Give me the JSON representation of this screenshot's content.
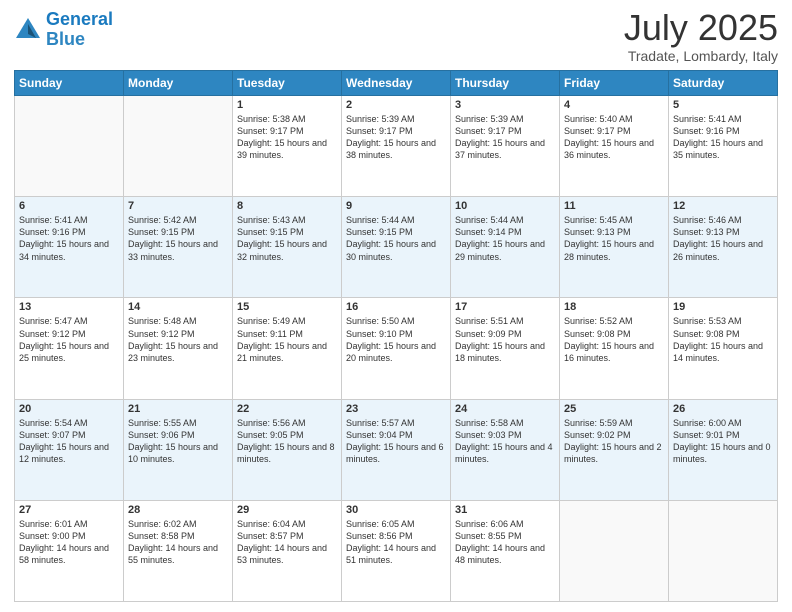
{
  "header": {
    "logo_line1": "General",
    "logo_line2": "Blue",
    "month_title": "July 2025",
    "location": "Tradate, Lombardy, Italy"
  },
  "days_of_week": [
    "Sunday",
    "Monday",
    "Tuesday",
    "Wednesday",
    "Thursday",
    "Friday",
    "Saturday"
  ],
  "weeks": [
    [
      {
        "day": "",
        "sunrise": "",
        "sunset": "",
        "daylight": ""
      },
      {
        "day": "",
        "sunrise": "",
        "sunset": "",
        "daylight": ""
      },
      {
        "day": "1",
        "sunrise": "Sunrise: 5:38 AM",
        "sunset": "Sunset: 9:17 PM",
        "daylight": "Daylight: 15 hours and 39 minutes."
      },
      {
        "day": "2",
        "sunrise": "Sunrise: 5:39 AM",
        "sunset": "Sunset: 9:17 PM",
        "daylight": "Daylight: 15 hours and 38 minutes."
      },
      {
        "day": "3",
        "sunrise": "Sunrise: 5:39 AM",
        "sunset": "Sunset: 9:17 PM",
        "daylight": "Daylight: 15 hours and 37 minutes."
      },
      {
        "day": "4",
        "sunrise": "Sunrise: 5:40 AM",
        "sunset": "Sunset: 9:17 PM",
        "daylight": "Daylight: 15 hours and 36 minutes."
      },
      {
        "day": "5",
        "sunrise": "Sunrise: 5:41 AM",
        "sunset": "Sunset: 9:16 PM",
        "daylight": "Daylight: 15 hours and 35 minutes."
      }
    ],
    [
      {
        "day": "6",
        "sunrise": "Sunrise: 5:41 AM",
        "sunset": "Sunset: 9:16 PM",
        "daylight": "Daylight: 15 hours and 34 minutes."
      },
      {
        "day": "7",
        "sunrise": "Sunrise: 5:42 AM",
        "sunset": "Sunset: 9:15 PM",
        "daylight": "Daylight: 15 hours and 33 minutes."
      },
      {
        "day": "8",
        "sunrise": "Sunrise: 5:43 AM",
        "sunset": "Sunset: 9:15 PM",
        "daylight": "Daylight: 15 hours and 32 minutes."
      },
      {
        "day": "9",
        "sunrise": "Sunrise: 5:44 AM",
        "sunset": "Sunset: 9:15 PM",
        "daylight": "Daylight: 15 hours and 30 minutes."
      },
      {
        "day": "10",
        "sunrise": "Sunrise: 5:44 AM",
        "sunset": "Sunset: 9:14 PM",
        "daylight": "Daylight: 15 hours and 29 minutes."
      },
      {
        "day": "11",
        "sunrise": "Sunrise: 5:45 AM",
        "sunset": "Sunset: 9:13 PM",
        "daylight": "Daylight: 15 hours and 28 minutes."
      },
      {
        "day": "12",
        "sunrise": "Sunrise: 5:46 AM",
        "sunset": "Sunset: 9:13 PM",
        "daylight": "Daylight: 15 hours and 26 minutes."
      }
    ],
    [
      {
        "day": "13",
        "sunrise": "Sunrise: 5:47 AM",
        "sunset": "Sunset: 9:12 PM",
        "daylight": "Daylight: 15 hours and 25 minutes."
      },
      {
        "day": "14",
        "sunrise": "Sunrise: 5:48 AM",
        "sunset": "Sunset: 9:12 PM",
        "daylight": "Daylight: 15 hours and 23 minutes."
      },
      {
        "day": "15",
        "sunrise": "Sunrise: 5:49 AM",
        "sunset": "Sunset: 9:11 PM",
        "daylight": "Daylight: 15 hours and 21 minutes."
      },
      {
        "day": "16",
        "sunrise": "Sunrise: 5:50 AM",
        "sunset": "Sunset: 9:10 PM",
        "daylight": "Daylight: 15 hours and 20 minutes."
      },
      {
        "day": "17",
        "sunrise": "Sunrise: 5:51 AM",
        "sunset": "Sunset: 9:09 PM",
        "daylight": "Daylight: 15 hours and 18 minutes."
      },
      {
        "day": "18",
        "sunrise": "Sunrise: 5:52 AM",
        "sunset": "Sunset: 9:08 PM",
        "daylight": "Daylight: 15 hours and 16 minutes."
      },
      {
        "day": "19",
        "sunrise": "Sunrise: 5:53 AM",
        "sunset": "Sunset: 9:08 PM",
        "daylight": "Daylight: 15 hours and 14 minutes."
      }
    ],
    [
      {
        "day": "20",
        "sunrise": "Sunrise: 5:54 AM",
        "sunset": "Sunset: 9:07 PM",
        "daylight": "Daylight: 15 hours and 12 minutes."
      },
      {
        "day": "21",
        "sunrise": "Sunrise: 5:55 AM",
        "sunset": "Sunset: 9:06 PM",
        "daylight": "Daylight: 15 hours and 10 minutes."
      },
      {
        "day": "22",
        "sunrise": "Sunrise: 5:56 AM",
        "sunset": "Sunset: 9:05 PM",
        "daylight": "Daylight: 15 hours and 8 minutes."
      },
      {
        "day": "23",
        "sunrise": "Sunrise: 5:57 AM",
        "sunset": "Sunset: 9:04 PM",
        "daylight": "Daylight: 15 hours and 6 minutes."
      },
      {
        "day": "24",
        "sunrise": "Sunrise: 5:58 AM",
        "sunset": "Sunset: 9:03 PM",
        "daylight": "Daylight: 15 hours and 4 minutes."
      },
      {
        "day": "25",
        "sunrise": "Sunrise: 5:59 AM",
        "sunset": "Sunset: 9:02 PM",
        "daylight": "Daylight: 15 hours and 2 minutes."
      },
      {
        "day": "26",
        "sunrise": "Sunrise: 6:00 AM",
        "sunset": "Sunset: 9:01 PM",
        "daylight": "Daylight: 15 hours and 0 minutes."
      }
    ],
    [
      {
        "day": "27",
        "sunrise": "Sunrise: 6:01 AM",
        "sunset": "Sunset: 9:00 PM",
        "daylight": "Daylight: 14 hours and 58 minutes."
      },
      {
        "day": "28",
        "sunrise": "Sunrise: 6:02 AM",
        "sunset": "Sunset: 8:58 PM",
        "daylight": "Daylight: 14 hours and 55 minutes."
      },
      {
        "day": "29",
        "sunrise": "Sunrise: 6:04 AM",
        "sunset": "Sunset: 8:57 PM",
        "daylight": "Daylight: 14 hours and 53 minutes."
      },
      {
        "day": "30",
        "sunrise": "Sunrise: 6:05 AM",
        "sunset": "Sunset: 8:56 PM",
        "daylight": "Daylight: 14 hours and 51 minutes."
      },
      {
        "day": "31",
        "sunrise": "Sunrise: 6:06 AM",
        "sunset": "Sunset: 8:55 PM",
        "daylight": "Daylight: 14 hours and 48 minutes."
      },
      {
        "day": "",
        "sunrise": "",
        "sunset": "",
        "daylight": ""
      },
      {
        "day": "",
        "sunrise": "",
        "sunset": "",
        "daylight": ""
      }
    ]
  ]
}
